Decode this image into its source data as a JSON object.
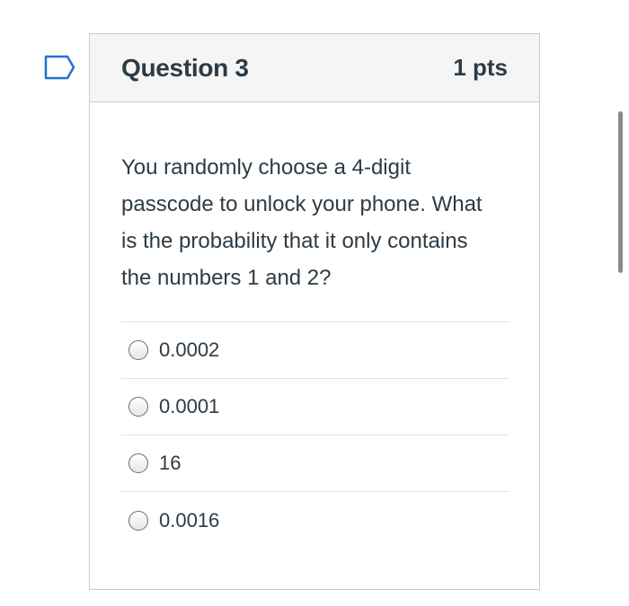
{
  "question": {
    "title": "Question 3",
    "points": "1 pts",
    "text": "You randomly choose a 4-digit passcode to unlock your phone. What is the probability that it only contains the numbers 1 and 2?",
    "answers": [
      {
        "label": "0.0002"
      },
      {
        "label": "0.0001"
      },
      {
        "label": "16"
      },
      {
        "label": "0.0016"
      }
    ]
  },
  "icons": {
    "flag": "flag-question-icon"
  },
  "colors": {
    "flag_outline": "#1f72d6",
    "text": "#2d3b45",
    "header_bg": "#f5f5f5",
    "border": "#c7cdd1"
  }
}
